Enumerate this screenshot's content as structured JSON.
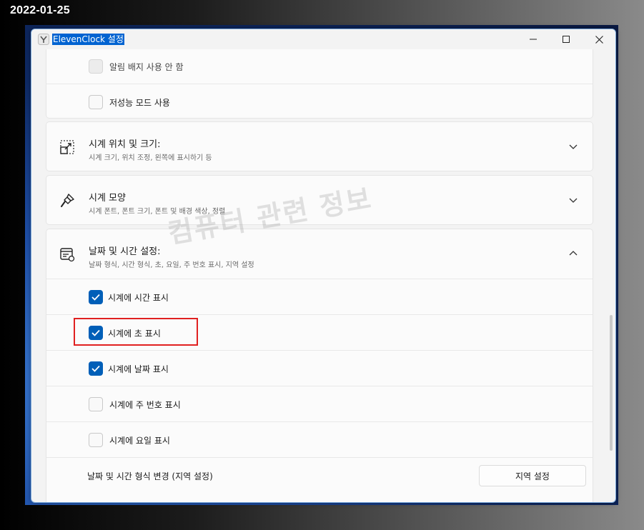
{
  "date_stamp": "2022-01-25",
  "window": {
    "title": "ElevenClock 설정",
    "minimize_icon": "minimize-icon",
    "maximize_icon": "maximize-icon",
    "close_icon": "close-icon"
  },
  "top_card": {
    "items": [
      {
        "label": "알림 배지 사용 안 함",
        "checked": false,
        "disabled": true
      },
      {
        "label": "저성능 모드 사용",
        "checked": false,
        "disabled": false
      }
    ]
  },
  "sections": [
    {
      "title": "시계 위치 및 크기:",
      "subtitle": "시계 크기, 위치 조정, 왼쪽에 표시하기 등",
      "icon": "resize-icon",
      "expanded": false
    },
    {
      "title": "시계 모양",
      "subtitle": "시계 폰트, 폰트 크기, 폰트 및 배경 색상, 정렬",
      "icon": "brush-icon",
      "expanded": false
    },
    {
      "title": "날짜 및 시간 설정:",
      "subtitle": "날짜 형식, 시간 형식, 초, 요일, 주 번호 표시, 지역 설정",
      "icon": "calendar-icon",
      "expanded": true
    }
  ],
  "datetime_options": [
    {
      "label": "시계에 시간 표시",
      "checked": true
    },
    {
      "label": "시계에 초 표시",
      "checked": true
    },
    {
      "label": "시계에 날짜 표시",
      "checked": true
    },
    {
      "label": "시계에 주 번호 표시",
      "checked": false
    },
    {
      "label": "시계에 요일 표시",
      "checked": false
    }
  ],
  "region_row": {
    "label": "날짜 및 시간 형식 변경 (지역 설정)",
    "button": "지역 설정"
  },
  "watermark": "컴퓨터 관련 정보",
  "colors": {
    "accent": "#005fb8",
    "highlight": "#e02020",
    "title_selection": "#0063d1"
  }
}
